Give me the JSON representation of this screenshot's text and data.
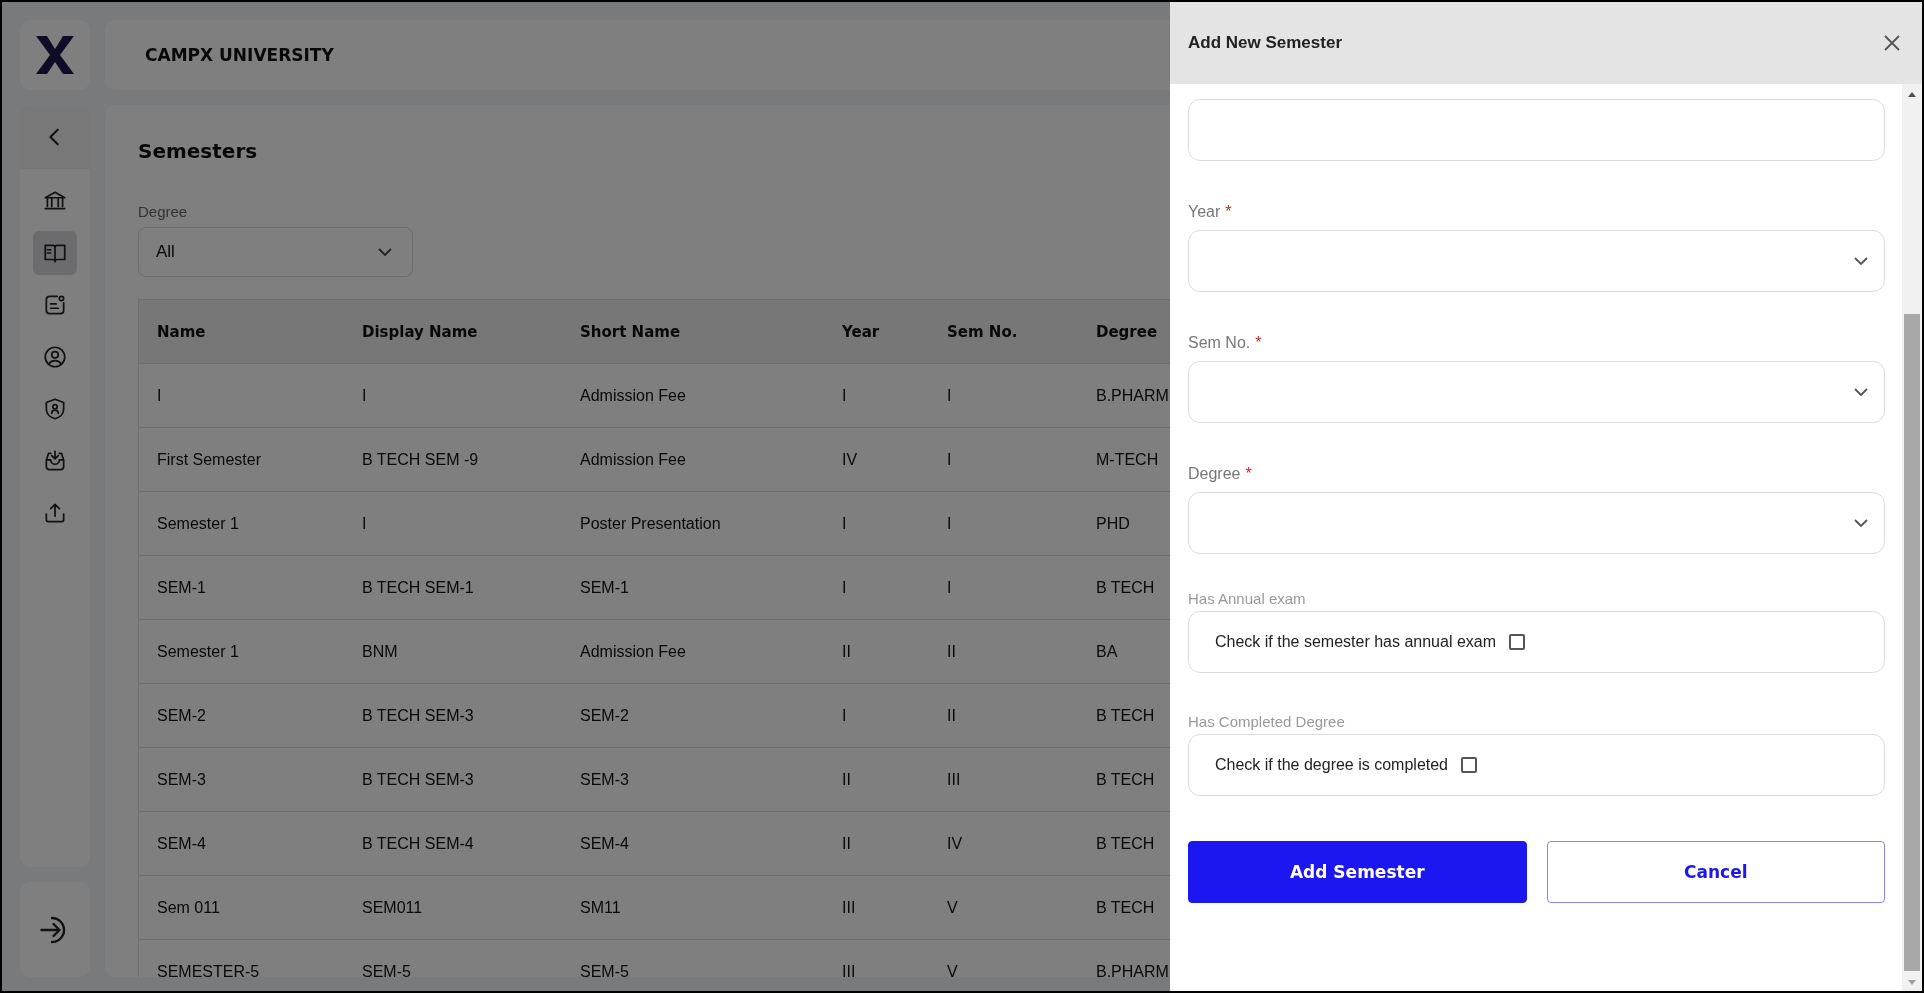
{
  "header": {
    "title": "CAMPX UNIVERSITY"
  },
  "sidebar": {
    "items": [
      {
        "selected": false
      },
      {
        "selected": true
      },
      {
        "selected": false
      },
      {
        "selected": false
      },
      {
        "selected": false
      },
      {
        "selected": false
      },
      {
        "selected": false
      }
    ]
  },
  "page": {
    "title": "Semesters",
    "filter": {
      "label": "Degree",
      "value": "All"
    },
    "table": {
      "columns": [
        "Name",
        "Display Name",
        "Short Name",
        "Year",
        "Sem No.",
        "Degree"
      ],
      "rows": [
        [
          "I",
          "I",
          "Admission Fee",
          "I",
          "I",
          "B.PHARM"
        ],
        [
          "First Semester",
          "B TECH SEM -9",
          "Admission Fee",
          "IV",
          "I",
          "M-TECH"
        ],
        [
          "Semester 1",
          "I",
          "Poster Presentation",
          "I",
          "I",
          "PHD"
        ],
        [
          "SEM-1",
          "B TECH SEM-1",
          "SEM-1",
          "I",
          "I",
          "B TECH"
        ],
        [
          "Semester 1",
          "BNM",
          "Admission Fee",
          "II",
          "II",
          "BA"
        ],
        [
          "SEM-2",
          "B TECH SEM-3",
          "SEM-2",
          "I",
          "II",
          "B TECH"
        ],
        [
          "SEM-3",
          "B TECH SEM-3",
          "SEM-3",
          "II",
          "III",
          "B TECH"
        ],
        [
          "SEM-4",
          "B TECH SEM-4",
          "SEM-4",
          "II",
          "IV",
          "B TECH"
        ],
        [
          "Sem 011",
          "SEM011",
          "SM11",
          "III",
          "V",
          "B TECH"
        ],
        [
          "SEMESTER-5",
          "SEM-5",
          "SEM-5",
          "III",
          "V",
          "B.PHARM"
        ]
      ]
    }
  },
  "drawer": {
    "title": "Add New Semester",
    "fields": [
      {
        "kind": "text"
      },
      {
        "kind": "select",
        "label": "Year",
        "required_mark": "*"
      },
      {
        "kind": "select",
        "label": "Sem No.",
        "required_mark": "*"
      },
      {
        "kind": "select",
        "label": "Degree",
        "required_mark": "*"
      }
    ],
    "checks": [
      {
        "label": "Has Annual exam",
        "text": "Check if the semester has annual exam",
        "checked": false
      },
      {
        "label": "Has Completed Degree",
        "text": "Check if the degree is completed",
        "checked": false
      }
    ],
    "buttons": [
      {
        "label": "Add Semester",
        "kind": "primary"
      },
      {
        "label": "Cancel",
        "kind": "secondary"
      }
    ]
  }
}
